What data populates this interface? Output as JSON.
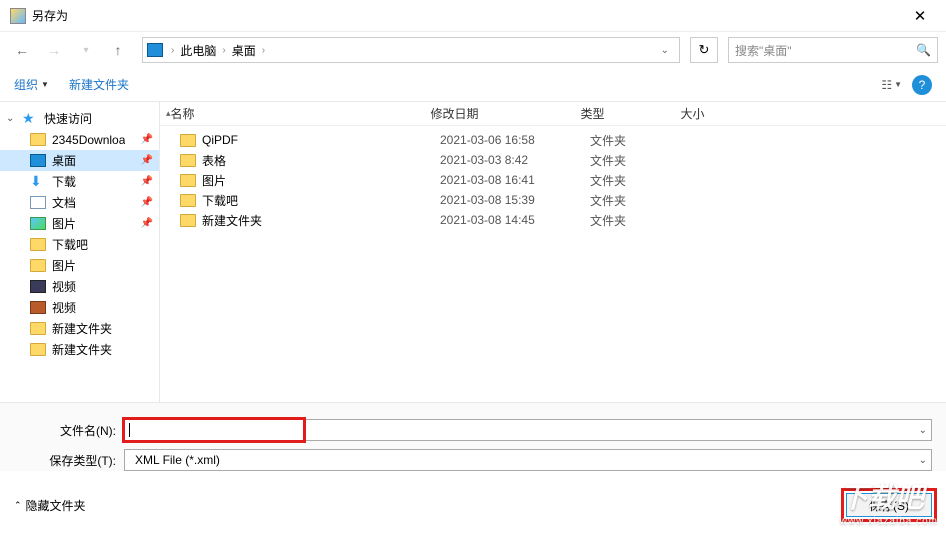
{
  "title": "另存为",
  "breadcrumb": {
    "root": "此电脑",
    "current": "桌面"
  },
  "search": {
    "placeholder": "搜索\"桌面\""
  },
  "toolbar": {
    "organize": "组织",
    "newfolder": "新建文件夹"
  },
  "columns": {
    "name": "名称",
    "date": "修改日期",
    "type": "类型",
    "size": "大小"
  },
  "sidebar": {
    "quick": "快速访问",
    "items": [
      {
        "label": "2345Downloa",
        "icon": "folder"
      },
      {
        "label": "桌面",
        "icon": "desktop",
        "selected": true
      },
      {
        "label": "下载",
        "icon": "down"
      },
      {
        "label": "文档",
        "icon": "doc"
      },
      {
        "label": "图片",
        "icon": "pic"
      },
      {
        "label": "下载吧",
        "icon": "folder"
      },
      {
        "label": "图片",
        "icon": "folder"
      },
      {
        "label": "视频",
        "icon": "vid"
      },
      {
        "label": "视频",
        "icon": "vid2"
      },
      {
        "label": "新建文件夹",
        "icon": "folder"
      },
      {
        "label": "新建文件夹",
        "icon": "folder"
      }
    ]
  },
  "files": [
    {
      "name": "QiPDF",
      "date": "2021-03-06 16:58",
      "type": "文件夹"
    },
    {
      "name": "表格",
      "date": "2021-03-03 8:42",
      "type": "文件夹"
    },
    {
      "name": "图片",
      "date": "2021-03-08 16:41",
      "type": "文件夹"
    },
    {
      "name": "下载吧",
      "date": "2021-03-08 15:39",
      "type": "文件夹"
    },
    {
      "name": "新建文件夹",
      "date": "2021-03-08 14:45",
      "type": "文件夹"
    }
  ],
  "fields": {
    "filename_label": "文件名(N):",
    "filename_value": "",
    "filetype_label": "保存类型(T):",
    "filetype_value": "XML File (*.xml)"
  },
  "footer": {
    "hide": "隐藏文件夹",
    "save": "保存(S)"
  },
  "watermark": {
    "main": "下载吧",
    "sub": "www.xiazaiba.com"
  }
}
